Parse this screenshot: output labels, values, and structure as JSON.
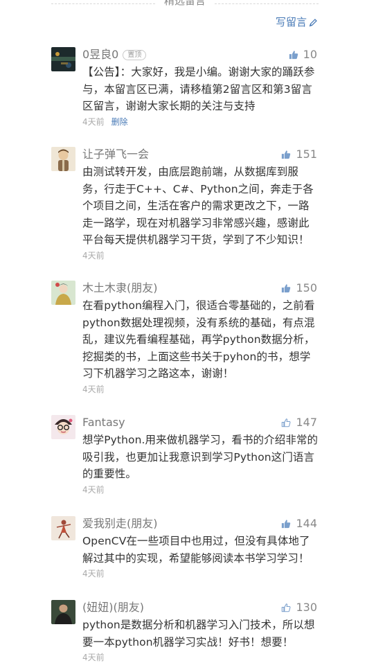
{
  "header": {
    "title": "精选留言",
    "write_label": "写留言"
  },
  "colors": {
    "link": "#4a7bb7",
    "text": "#333333",
    "muted": "#888888"
  },
  "comments": [
    {
      "nickname": "0昱良0",
      "badge": "置顶",
      "likes": "10",
      "content": "【公告】：大家好，我是小编。谢谢大家的踊跃参与，本留言区已满，请移植第2留言区和第3留言区留言，谢谢大家长期的关注与支持",
      "time": "4天前",
      "delete_label": "删除",
      "avatar_icon": "dark-landscape-avatar"
    },
    {
      "nickname": "让子弹飞一会",
      "likes": "151",
      "content": "由测试转开发，由底层跑前端，从数据库到服务，行走于C++、C#、Python之间，奔走于各个项目之间，生活在客户的需求更改之下，一路走一路学，现在对机器学习非常感兴趣，感谢此平台每天提供机器学习干货，学到了不少知识！",
      "time": "4天前",
      "avatar_icon": "cartoon-figure-avatar"
    },
    {
      "nickname": "木土木隶(朋友)",
      "likes": "150",
      "content": "在看python编程入门，很适合零基础的，之前看python数据处理视频，没有系统的基础，有点混乱，建议先看编程基础，再学python数据分析，挖掘类的书，上面这些书关于pyhon的书，想学习下机器学习之路这本，谢谢！",
      "time": "4天前",
      "avatar_icon": "costume-portrait-avatar"
    },
    {
      "nickname": "Fantasy",
      "likes": "147",
      "content": "想学Python.用来做机器学习，看书的介绍非常的吸引我，也更加让我意识到学习Python这门语言的重要性。",
      "time": "4天前",
      "avatar_icon": "cartoon-glasses-avatar"
    },
    {
      "nickname": "爱我别走(朋友)",
      "likes": "144",
      "content": "OpenCV在一些项目中也用过，但没有具体地了解过其中的实现，希望能够阅读本书学习学习！",
      "time": "4天前",
      "avatar_icon": "dancer-avatar"
    },
    {
      "nickname": "(妞妞)(朋友)",
      "likes": "130",
      "content": "python是数据分析和机器学习入门技术，所以想要一本python机器学习实战！好书！想要！",
      "time": "4天前",
      "avatar_icon": "man-portrait-avatar"
    }
  ]
}
